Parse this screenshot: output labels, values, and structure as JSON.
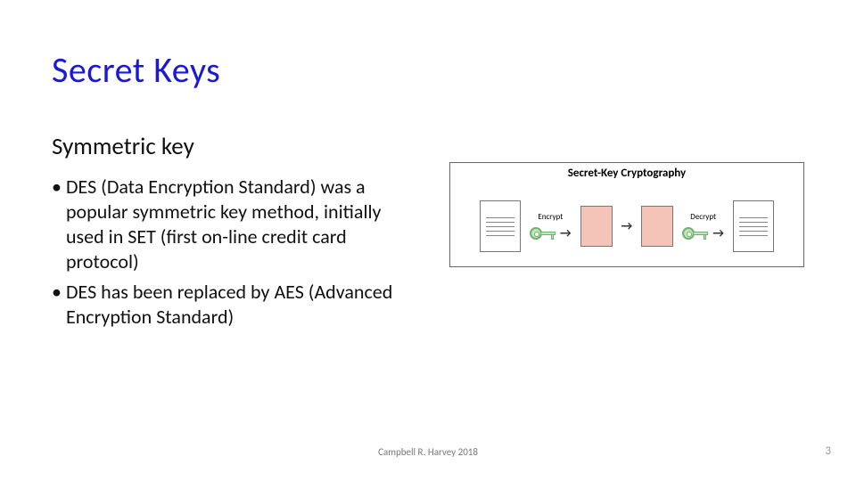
{
  "title": "Secret Keys",
  "subtitle": "Symmetric key",
  "bullets": [
    "DES (Data Encryption Standard) was a popular symmetric key method, initially used in SET (first on-line credit card protocol)",
    "DES has been replaced by AES (Advanced Encryption Standard)"
  ],
  "diagram": {
    "title": "Secret-Key Cryptography",
    "encrypt_label": "Encrypt",
    "decrypt_label": "Decrypt"
  },
  "footer": "Campbell R. Harvey 2018",
  "page_number": "3"
}
